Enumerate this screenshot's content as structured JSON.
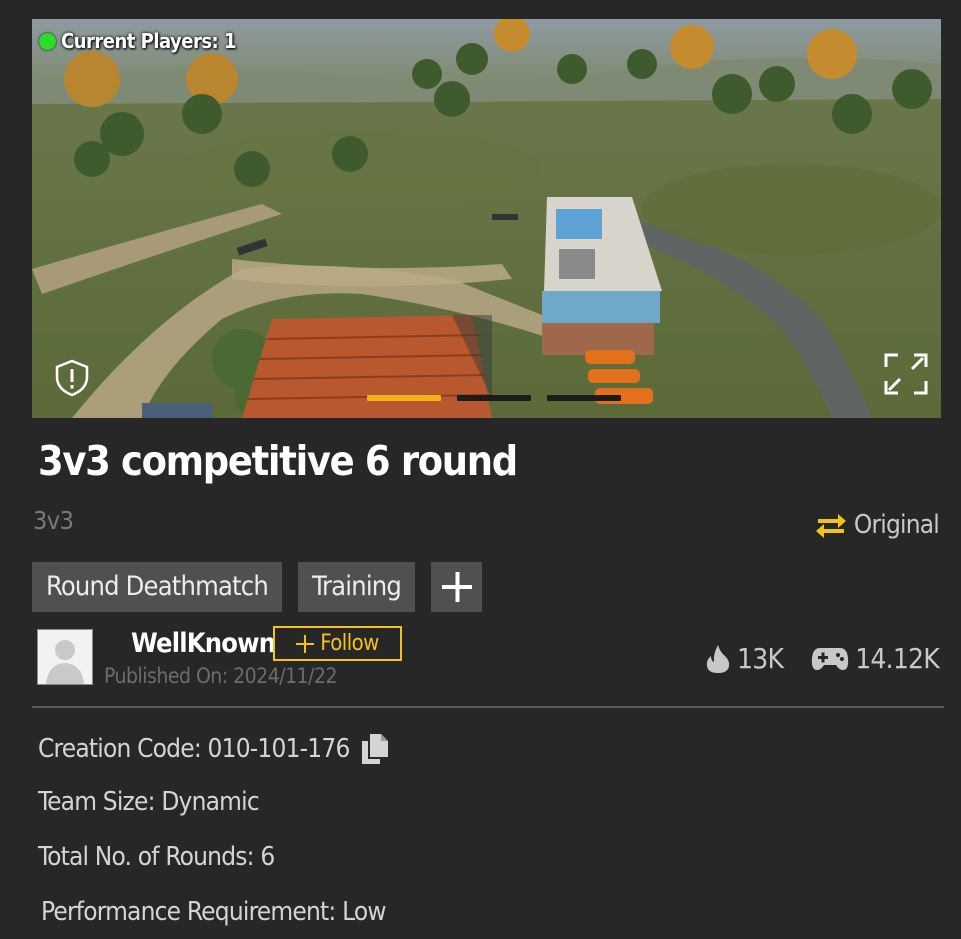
{
  "preview": {
    "current_players": "Current Players: 1",
    "carousel_active_index": 0,
    "carousel_count": 3
  },
  "map": {
    "title": "3v3 competitive 6 round",
    "mode": "3v3",
    "original_label": "Original",
    "tags": [
      "Round Deathmatch",
      "Training"
    ]
  },
  "author": {
    "name": "WellKnown",
    "follow_label": "Follow",
    "published": "Published On: 2024/11/22"
  },
  "stats": {
    "popularity": "13K",
    "plays": "14.12K"
  },
  "details": {
    "creation_code": "Creation Code: 010-101-176",
    "team_size": "Team Size: Dynamic",
    "rounds": "Total No. of Rounds: 6",
    "performance": "Performance Requirement: Low"
  },
  "colors": {
    "accent": "#f4c21c",
    "online": "#2bdc2b",
    "background": "#272727"
  }
}
